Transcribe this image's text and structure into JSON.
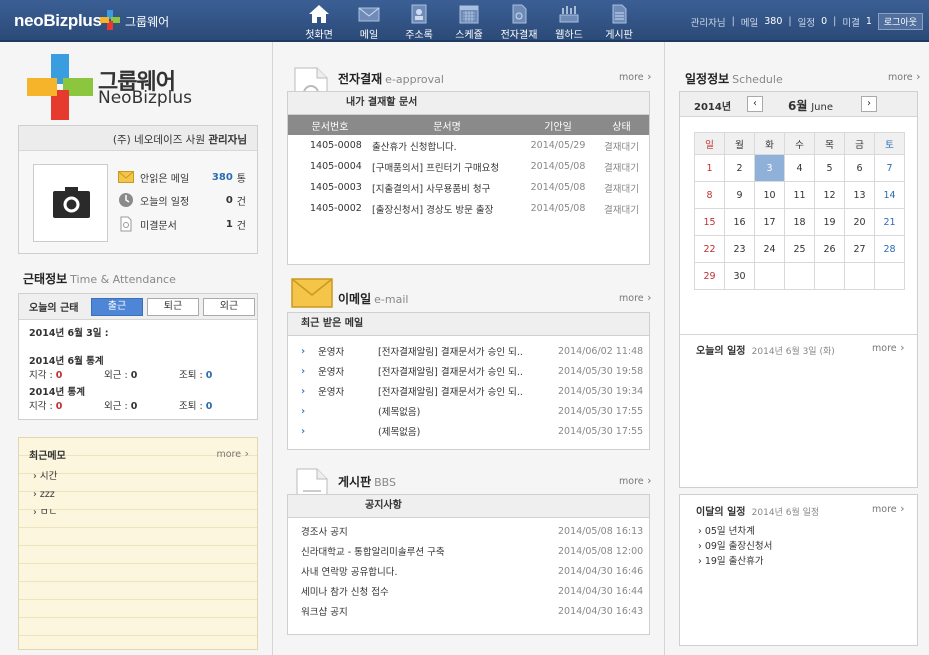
{
  "header": {
    "brand": "neoBizplus",
    "brand_sub": "그룹웨어",
    "nav": [
      {
        "label": "첫화면",
        "icon": "home-icon"
      },
      {
        "label": "메일",
        "icon": "mail-icon"
      },
      {
        "label": "주소록",
        "icon": "addressbook-icon"
      },
      {
        "label": "스케쥴",
        "icon": "calendar-icon"
      },
      {
        "label": "전자결재",
        "icon": "approval-icon"
      },
      {
        "label": "웹하드",
        "icon": "webhard-icon"
      },
      {
        "label": "게시판",
        "icon": "board-icon"
      }
    ],
    "user": "관리자님",
    "mail_label": "메일",
    "mail_count": "380",
    "schedule_label": "일정",
    "schedule_count": "0",
    "pending_label": "미결",
    "pending_count": "1",
    "logout": "로그아웃"
  },
  "brand_logo": {
    "line1": "그룹웨어",
    "line2": "NeoBizplus"
  },
  "profile": {
    "company": "(주) 네오데이즈 사원",
    "name": "관리자님",
    "stats": [
      {
        "label": "안읽은 메일",
        "value": "380",
        "unit": "통",
        "icon": "envelope-icon"
      },
      {
        "label": "오늘의 일정",
        "value": "0",
        "unit": "건",
        "icon": "clock-icon"
      },
      {
        "label": "미결문서",
        "value": "1",
        "unit": "건",
        "icon": "document-icon"
      }
    ]
  },
  "attendance": {
    "title": "근태정보",
    "subtitle": "Time & Attendance",
    "today_label": "오늘의 근태",
    "buttons": [
      "출근",
      "퇴근",
      "외근"
    ],
    "date_line": "2014년 6월 3일 :",
    "month_stats": "2014년 6월 통계",
    "year_stats": "2014년 통계",
    "late_label": "지각 :",
    "out_label": "외근 :",
    "early_label": "조퇴 :",
    "month": {
      "late": "0",
      "out": "0",
      "early": "0"
    },
    "year": {
      "late": "0",
      "out": "0",
      "early": "0"
    }
  },
  "memo": {
    "title": "최근메모",
    "more": "more",
    "items": [
      "시간",
      "zzz",
      "ㅁㄴ"
    ]
  },
  "approval": {
    "title": "전자결재",
    "subtitle": "e-approval",
    "more": "more",
    "tab": "내가 결재할 문서",
    "columns": [
      "문서번호",
      "문서명",
      "기안일",
      "상태"
    ],
    "rows": [
      [
        "1405-0008",
        "출산휴가 신청합니다.",
        "2014/05/29",
        "결재대기"
      ],
      [
        "1405-0004",
        "[구매품의서] 프린터기 구매요청",
        "2014/05/08",
        "결재대기"
      ],
      [
        "1405-0003",
        "[지출결의서] 사무용품비 청구",
        "2014/05/08",
        "결재대기"
      ],
      [
        "1405-0002",
        "[출장신청서] 경상도 방문 출장",
        "2014/05/08",
        "결재대기"
      ]
    ]
  },
  "email": {
    "title": "이메일",
    "subtitle": "e-mail",
    "more": "more",
    "tab": "최근 받은 메일",
    "rows": [
      [
        "운영자",
        "[전자결재알림] 결재문서가 승인 되..",
        "2014/06/02 11:48"
      ],
      [
        "운영자",
        "[전자결재알림] 결재문서가 승인 되..",
        "2014/05/30 19:58"
      ],
      [
        "운영자",
        "[전자결재알림] 결재문서가 승인 되..",
        "2014/05/30 19:34"
      ],
      [
        "",
        "(제목없음)",
        "2014/05/30 17:55"
      ],
      [
        "",
        "(제목없음)",
        "2014/05/30 17:55"
      ]
    ]
  },
  "board": {
    "title": "게시판",
    "subtitle": "BBS",
    "more": "more",
    "tab": "공지사항",
    "rows": [
      [
        "경조사 공지",
        "2014/05/08 16:13"
      ],
      [
        "신라대학교 - 통합알리미솔루션 구축",
        "2014/05/08 12:00"
      ],
      [
        "사내 연락망 공유합니다.",
        "2014/04/30 16:46"
      ],
      [
        "세미나 참가 신청 접수",
        "2014/04/30 16:44"
      ],
      [
        "워크샵 공지",
        "2014/04/30 16:43"
      ]
    ]
  },
  "schedule": {
    "title": "일정정보",
    "subtitle": "Schedule",
    "more": "more",
    "year": "2014년",
    "month": "6월",
    "month_en": "June",
    "weekdays": [
      "일",
      "월",
      "화",
      "수",
      "목",
      "금",
      "토"
    ],
    "weeks": [
      [
        "1",
        "2",
        "3",
        "4",
        "5",
        "6",
        "7"
      ],
      [
        "8",
        "9",
        "10",
        "11",
        "12",
        "13",
        "14"
      ],
      [
        "15",
        "16",
        "17",
        "18",
        "19",
        "20",
        "21"
      ],
      [
        "22",
        "23",
        "24",
        "25",
        "26",
        "27",
        "28"
      ],
      [
        "29",
        "30",
        "",
        "",
        "",
        "",
        ""
      ]
    ],
    "today_title": "오늘의 일정",
    "today_date": "2014년 6월 3일 (화)",
    "today_more": "more"
  },
  "monthly": {
    "title": "이달의 일정",
    "subtitle": "2014년 6월 일정",
    "more": "more",
    "items": [
      "05일 년차계",
      "09일 출장신청서",
      "19일 출산휴가"
    ]
  },
  "colors": {
    "topbar": "#2b4a78",
    "accent_blue": "#2b6cb0",
    "red": "#c03030",
    "today_cell": "#8fb0d8",
    "memo_bg": "#fdf6df"
  }
}
